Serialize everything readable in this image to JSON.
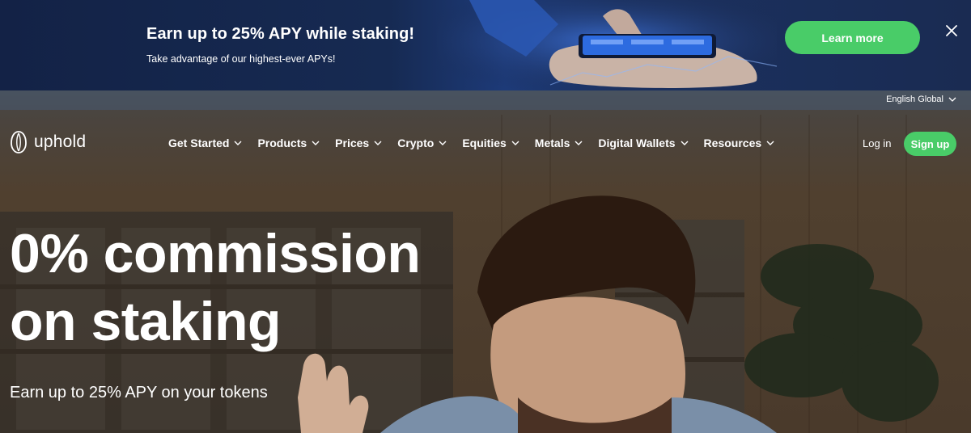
{
  "promo": {
    "title": "Earn up to 25% APY while staking!",
    "subtitle": "Take advantage of our highest-ever APYs!",
    "cta_label": "Learn more",
    "close_icon": "close-icon"
  },
  "language": {
    "label": "English Global",
    "icon": "chevron-down-icon"
  },
  "header": {
    "logo_text": "uphold",
    "logo_icon": "uphold-logo-icon",
    "nav": [
      {
        "label": "Get Started"
      },
      {
        "label": "Products"
      },
      {
        "label": "Prices"
      },
      {
        "label": "Crypto"
      },
      {
        "label": "Equities"
      },
      {
        "label": "Metals"
      },
      {
        "label": "Digital Wallets"
      },
      {
        "label": "Resources"
      }
    ],
    "login_label": "Log in",
    "signup_label": "Sign up"
  },
  "hero": {
    "title_line1": "0% commission",
    "title_line2": "on staking",
    "subtitle": "Earn up to 25% APY on your tokens"
  },
  "colors": {
    "accent_green": "#49cc68",
    "banner_navy": "#132246",
    "text_white": "#ffffff"
  }
}
